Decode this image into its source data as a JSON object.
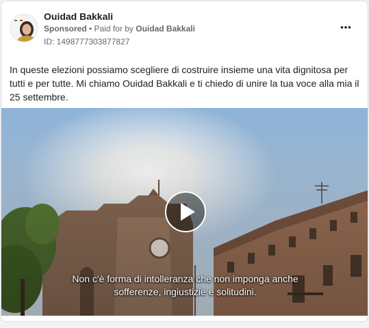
{
  "post": {
    "page_name": "Ouidad Bakkali",
    "sponsored_label": "Sponsored",
    "separator": " • ",
    "paid_for_prefix": "Paid for by ",
    "paid_for_name": "Ouidad Bakkali",
    "ad_id": "ID: 1498777303877827",
    "more_icon": "more-horizontal-icon",
    "text": "In queste elezioni possiamo scegliere di costruire insieme una vita dignitosa per tutti e per tutte. Mi chiamo Ouidad Bakkali e ti chiedo di unire la tua voce alla mia il 25 settembre."
  },
  "video": {
    "play_icon": "play-icon",
    "subtitle_line_1": "Non c'è forma di intolleranza che non imponga anche",
    "subtitle_line_2": "sofferenze, ingiustizie e solitudini."
  },
  "colors": {
    "text_primary": "#1c1e21",
    "text_secondary": "#65676b",
    "card_border": "#dddfe2",
    "background": "#f0f2f5"
  }
}
